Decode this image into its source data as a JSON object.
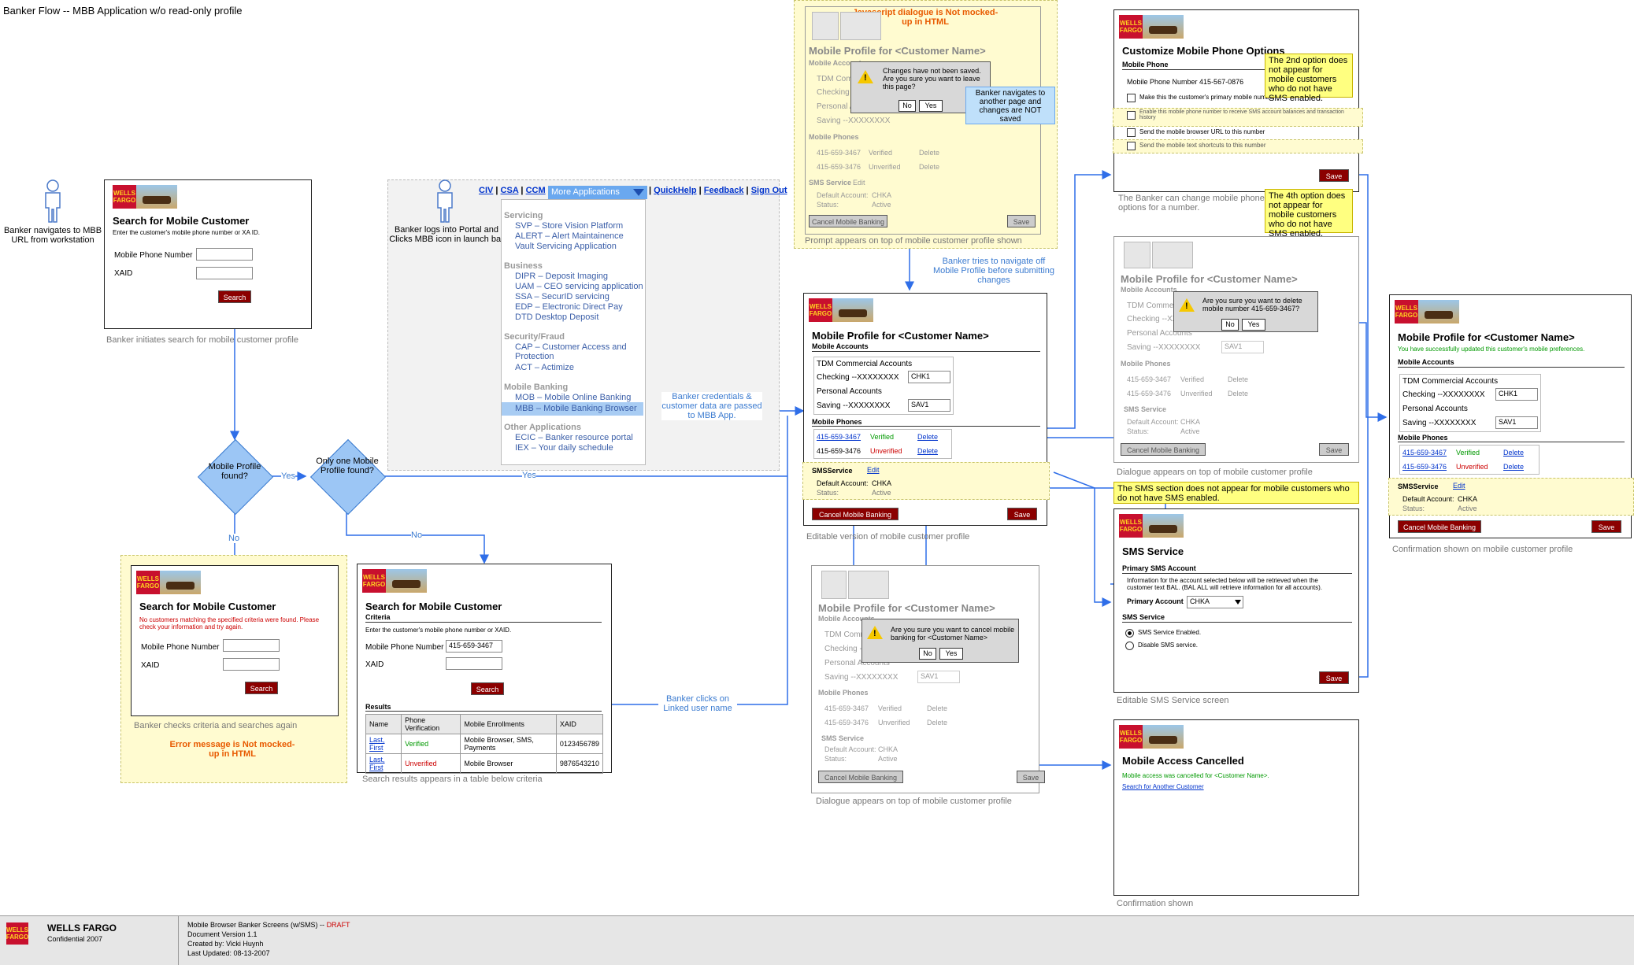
{
  "page_title": "Banker Flow -- MBB Application w/o read-only profile",
  "actors": {
    "actor1": "Banker navigates to MBB URL from workstation",
    "actor2": "Banker logs into Portal and Clicks MBB icon in launch bar"
  },
  "decisions": {
    "d1": "Mobile Profile found?",
    "d2": "Only one Mobile Profile found?",
    "yes": "Yes",
    "no": "No"
  },
  "portal": {
    "nav": [
      "CIV",
      "CSA",
      "CCM"
    ],
    "more_apps": "More Applications",
    "links": [
      "QuickHelp",
      "Feedback",
      "Sign Out"
    ],
    "sections": [
      {
        "heading": "Servicing",
        "items": [
          "SVP – Store Vision Platform",
          "ALERT – Alert Maintainence",
          "Vault Servicing Application"
        ]
      },
      {
        "heading": "Business",
        "items": [
          "DIPR – Deposit Imaging",
          "UAM – CEO servicing application",
          "SSA – SecurID servicing",
          "EDP – Electronic Direct Pay",
          "DTD Desktop Deposit"
        ]
      },
      {
        "heading": "Security/Fraud",
        "items": [
          "CAP – Customer Access and Protection",
          "ACT – Actimize"
        ]
      },
      {
        "heading": "Mobile Banking",
        "items": [
          "MOB – Mobile Online Banking",
          "MBB – Mobile Banking Browser"
        ]
      },
      {
        "heading": "Other Applications",
        "items": [
          "ECIC – Banker resource portal",
          "IEX – Your daily schedule"
        ]
      }
    ]
  },
  "logo": {
    "brand": "WELLS FARGO"
  },
  "search": {
    "title": "Search for Mobile Customer",
    "instruction": "Enter the customer's mobile phone number or XA ID.",
    "phone_label": "Mobile Phone Number",
    "xaid_label": "XAID",
    "search_btn": "Search",
    "caption": "Banker initiates search for mobile customer profile"
  },
  "search_error": {
    "error_msg": "No customers matching the specified criteria were found. Please check your information and try again.",
    "caption": "Banker checks criteria and searches again",
    "note": "Error message is Not mocked-up in HTML"
  },
  "search_results": {
    "criteria": "Criteria",
    "instruction": "Enter the customer's mobile phone number or XAID.",
    "phone_value": "415-659-3467",
    "results_label": "Results",
    "headers": [
      "Name",
      "Phone Verification",
      "Mobile Enrollments",
      "XAID"
    ],
    "rows": [
      {
        "name": "Last, First",
        "verification": "Verified",
        "enrollments": "Mobile Browser, SMS, Payments",
        "xaid": "0123456789"
      },
      {
        "name": "Last, First",
        "verification": "Unverified",
        "enrollments": "Mobile Browser",
        "xaid": "9876543210"
      }
    ],
    "caption": "Search results appears in a table below criteria"
  },
  "profile": {
    "title": "Mobile Profile for <Customer Name>",
    "accounts_label": "Mobile Accounts",
    "tdm": "TDM Commercial Accounts",
    "checking": "Checking --XXXXXXXX",
    "checking_code": "CHK1",
    "personal": "Personal Accounts",
    "saving": "Saving --XXXXXXXX",
    "saving_code": "SAV1",
    "phones_label": "Mobile Phones",
    "phone1": "415-659-3467",
    "phone1_status": "Verified",
    "phone2": "415-659-3476",
    "phone2_status": "Unverified",
    "delete": "Delete",
    "sms_label": "SMSService",
    "sms_label_faded": "SMS Service",
    "edit": "Edit",
    "default_account_label": "Default Account:",
    "default_account": "CHKA",
    "status_label": "Status:",
    "status": "Active",
    "cancel_btn": "Cancel Mobile Banking",
    "save_btn": "Save",
    "caption_edit": "Editable version of mobile customer profile",
    "caption_confirm": "Confirmation shown on mobile customer profile",
    "success_msg": "You have successfully updated this customer's mobile preferences."
  },
  "js_note": "Javascript dialogue is Not mocked-up in HTML",
  "leave_dialog": {
    "text": "Changes have not been saved. Are you sure you want to leave this page?",
    "no": "No",
    "yes": "Yes",
    "callout": "Banker navigates to another page and changes are NOT saved",
    "caption": "Prompt appears on top of mobile customer profile shown"
  },
  "delete_dialog": {
    "text": "Are you sure you want to delete mobile number 415-659-3467?",
    "caption": "Dialogue appears on top of mobile customer profile"
  },
  "cancel_dialog": {
    "text": "Are you sure you want to cancel mobile banking for <Customer Name>",
    "caption": "Dialogue appears on top of mobile customer profile"
  },
  "customize": {
    "title": "Customize Mobile Phone Options",
    "phone_label": "Mobile Phone",
    "phone_number": "Mobile Phone Number 415-567-0876",
    "opt1": "Make this the customer's primary mobile number",
    "opt2": "Enable this mobile phone number to receive SMS account balances and transaction history",
    "opt3": "Send the mobile browser URL to this number",
    "opt4": "Send the mobile text shortcuts to this number",
    "callout2": "The 2nd option does not appear for mobile customers who do not have SMS enabled.",
    "callout4": "The 4th option does not appear for mobile customers who do not have SMS enabled.",
    "caption": "The Banker can change mobile phone options for a number."
  },
  "sms_service": {
    "title": "SMS Service",
    "primary_label": "Primary SMS Account",
    "info": "Information for the account selected below will be retrieved when the customer text BAL. (BAL ALL will retrieve information for all accounts).",
    "primary_account_label": "Primary Account",
    "primary_account": "CHKA",
    "service_label": "SMS Service",
    "enabled": "SMS Service Enabled.",
    "disable": "Disable SMS service.",
    "callout": "The SMS section does not appear for mobile customers who do not have SMS enabled.",
    "caption": "Editable SMS Service screen"
  },
  "cancelled": {
    "title": "Mobile Access Cancelled",
    "msg": "Mobile access was cancelled for <Customer Name>.",
    "link": "Search for Another Customer",
    "caption": "Confirmation shown"
  },
  "flow_labels": {
    "credentials": "Banker credentials & customer data are passed to MBB App.",
    "navigate_off": "Banker tries to navigate off Mobile Profile before submitting changes",
    "clicks_linked": "Banker clicks on Linked user name"
  },
  "footer": {
    "brand": "WELLS FARGO",
    "confidential": "Confidential 2007",
    "doc_title": "Mobile Browser Banker Screens (w/SMS) --",
    "draft": "DRAFT",
    "version": "Document Version 1.1",
    "created": "Created by: Vicki Huynh",
    "updated": "Last Updated: 08-13-2007"
  }
}
